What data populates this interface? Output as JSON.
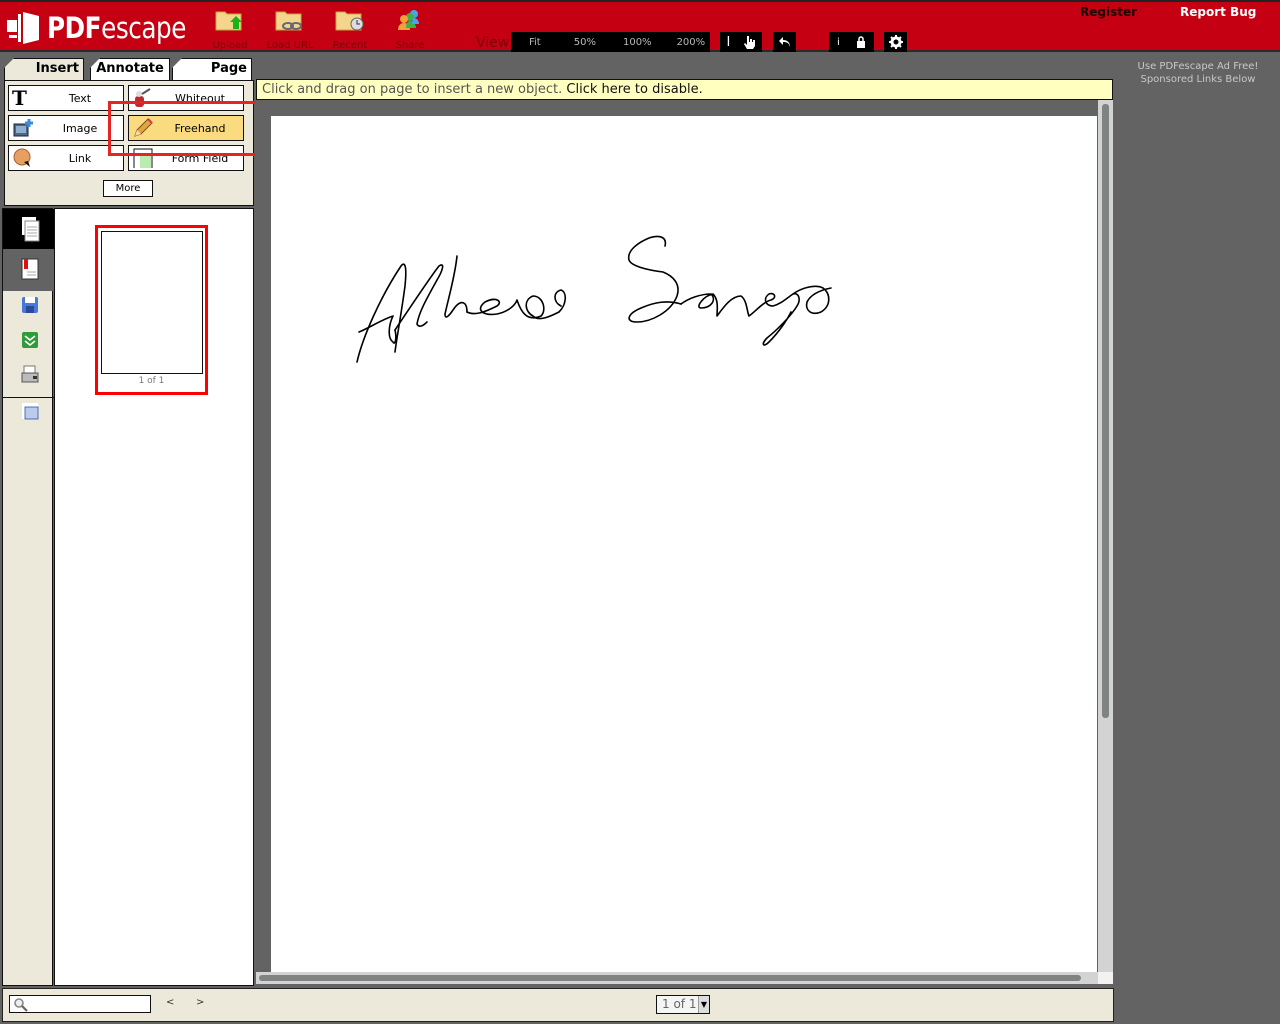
{
  "app": {
    "brand_bold": "PDF",
    "brand_light": "escape"
  },
  "toolbar": {
    "buttons": [
      {
        "label": "Upload",
        "icon": "folder-upload-icon"
      },
      {
        "label": "Load URL",
        "icon": "folder-link-icon"
      },
      {
        "label": "Recent",
        "icon": "folder-clock-icon"
      },
      {
        "label": "Share",
        "icon": "people-icon"
      }
    ],
    "view_label": "View",
    "zoom_options": [
      "Fit",
      "50%",
      "100%",
      "200%"
    ],
    "register": "Register",
    "report_bug": "Report Bug",
    "info_glyph": "i"
  },
  "ad": {
    "line1": "Use PDFescape Ad Free!",
    "line2": "Sponsored Links Below"
  },
  "tabs": [
    {
      "label": "Insert",
      "active": true
    },
    {
      "label": "Annotate",
      "active": false
    },
    {
      "label": "Page",
      "active": false
    }
  ],
  "insert_tools": [
    {
      "label": "Text",
      "icon": "text-t-icon"
    },
    {
      "label": "Whiteout",
      "icon": "whiteout-icon"
    },
    {
      "label": "Image",
      "icon": "image-insert-icon"
    },
    {
      "label": "Freehand",
      "icon": "pencil-icon",
      "active": true
    },
    {
      "label": "Link",
      "icon": "link-globe-icon"
    },
    {
      "label": "Form Field",
      "icon": "form-field-icon"
    }
  ],
  "more_label": "More",
  "thumbnails": {
    "label": "1 of 1"
  },
  "hint": {
    "text": "Click and drag on page to insert a new object. ",
    "link": "Click here to disable."
  },
  "document": {
    "content": "Handwritten signature (freehand drawing)",
    "stroke_color": "#000000"
  },
  "bottom": {
    "search_placeholder": "",
    "prev": "<",
    "next": ">",
    "page_indicator": "1 of 1"
  },
  "colors": {
    "header": "#c50013",
    "panel": "#ece9db",
    "active_tool": "#fbdb80",
    "hint_bg": "#ffffc0",
    "highlight": "#e52424"
  }
}
